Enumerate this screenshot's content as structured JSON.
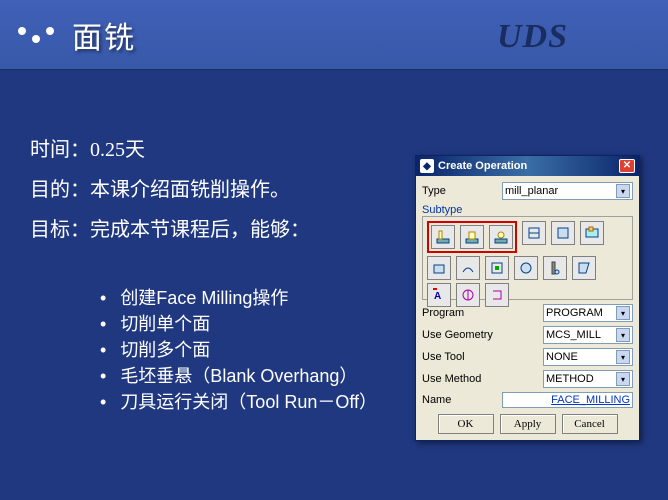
{
  "header": {
    "title": "面铣",
    "brand": "UDS"
  },
  "content": {
    "time_label": "时间：",
    "time_value": "0.25天",
    "purpose_label": "目的：",
    "purpose_value": "本课介绍面铣削操作。",
    "goal_label": "目标：",
    "goal_value": "完成本节课程后，能够："
  },
  "bullets": [
    "创建Face Milling操作",
    "切削单个面",
    "切削多个面",
    "毛坯垂悬（Blank Overhang）",
    "刀具运行关闭（Tool Run－Off）"
  ],
  "dialog": {
    "title": "Create Operation",
    "type_label": "Type",
    "type_value": "mill_planar",
    "subtype_label": "Subtype",
    "program_label": "Program",
    "program_value": "PROGRAM",
    "geometry_label": "Use Geometry",
    "geometry_value": "MCS_MILL",
    "tool_label": "Use Tool",
    "tool_value": "NONE",
    "method_label": "Use Method",
    "method_value": "METHOD",
    "name_label": "Name",
    "name_value": "FACE_MILLING",
    "buttons": {
      "ok": "OK",
      "apply": "Apply",
      "cancel": "Cancel"
    }
  }
}
